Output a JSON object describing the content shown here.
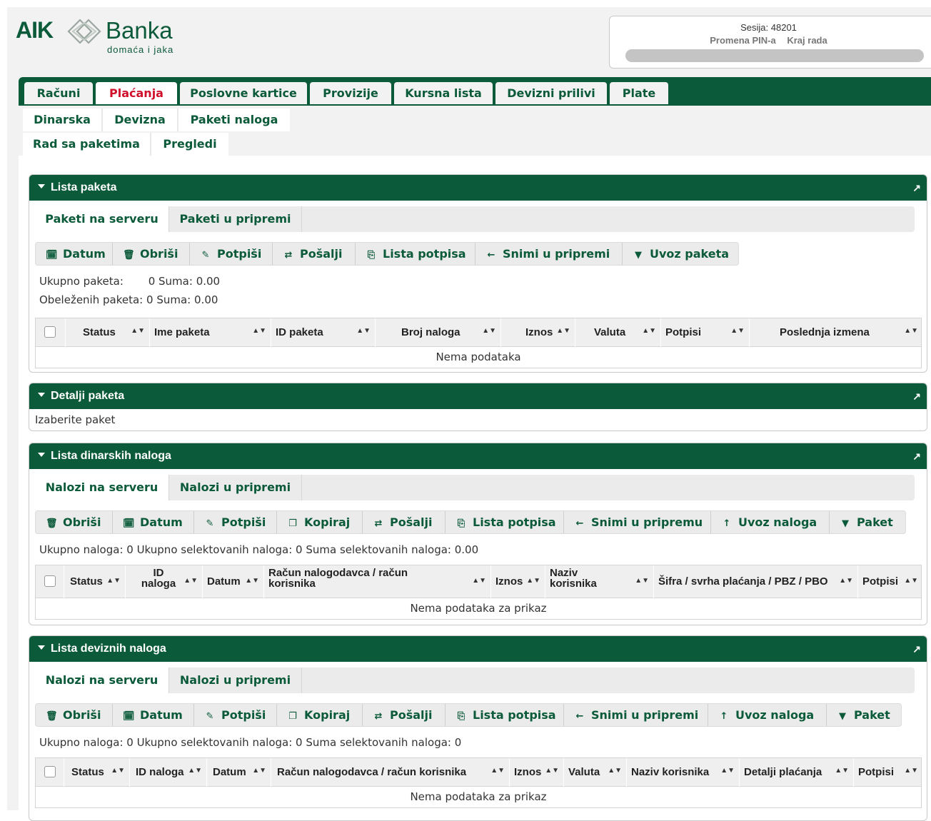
{
  "brand": {
    "name_left": "AIK",
    "name_right": "Banka",
    "tagline": "domaća i jaka",
    "color": "#0b5a3a"
  },
  "session": {
    "label": "Sesija:",
    "id": "48201",
    "change_pin": "Promena PIN-a",
    "logout": "Kraj rada"
  },
  "main_nav": [
    "Računi",
    "Plaćanja",
    "Poslovne kartice",
    "Provizije",
    "Kursna lista",
    "Devizni prilivi",
    "Plate"
  ],
  "sub_nav_1": [
    "Dinarska",
    "Devizna",
    "Paketi naloga"
  ],
  "sub_nav_2": [
    "Rad sa paketima",
    "Pregledi"
  ],
  "panels": {
    "lista_paketa": {
      "title": "Lista paketa",
      "tabs": [
        "Paketi na serveru",
        "Paketi u pripremi"
      ],
      "toolbar": [
        "Datum",
        "Obriši",
        "Potpiši",
        "Pošalji",
        "Lista potpisa",
        "Snimi u pripremi",
        "Uvoz paketa"
      ],
      "ukupno_label": "Ukupno paketa:",
      "ukupno_count": "0",
      "obelezeno_label": "Obeleženih paketa:",
      "obelezeno_count": "0",
      "suma_label": "Suma:",
      "suma_value": "0.00",
      "columns": [
        "Status",
        "Ime paketa",
        "ID paketa",
        "Broj naloga",
        "Iznos",
        "Valuta",
        "Potpisi",
        "Poslednja izmena"
      ],
      "empty": "Nema podataka"
    },
    "detalji_paketa": {
      "title": "Detalji paketa",
      "text": "Izaberite paket"
    },
    "lista_dinarskih": {
      "title": "Lista dinarskih naloga",
      "tabs": [
        "Nalozi na serveru",
        "Nalozi u pripremi"
      ],
      "toolbar": [
        "Obriši",
        "Datum",
        "Potpiši",
        "Kopiraj",
        "Pošalji",
        "Lista potpisa",
        "Snimi u pripremu",
        "Uvoz naloga",
        "Paket"
      ],
      "info": "Ukupno naloga:  0  Ukupno selektovanih naloga:  0  Suma selektovanih naloga:  0.00",
      "columns": [
        "Status",
        "ID\nnaloga",
        "Datum",
        "Račun nalogodavca / račun\nkorisnika",
        "Iznos",
        "Naziv\nkorisnika",
        "Šifra / svrha plaćanja / PBZ / PBO",
        "Potpisi"
      ],
      "empty": "Nema podataka za prikaz"
    },
    "lista_deviznih": {
      "title": "Lista deviznih naloga",
      "tabs": [
        "Nalozi na serveru",
        "Nalozi u pripremi"
      ],
      "toolbar": [
        "Obriši",
        "Datum",
        "Potpiši",
        "Kopiraj",
        "Pošalji",
        "Lista potpisa",
        "Snimi u pripremi",
        "Uvoz naloga",
        "Paket"
      ],
      "info": "Ukupno naloga:  0  Ukupno selektovanih naloga:  0  Suma selektovanih naloga:  0",
      "columns": [
        "Status",
        "ID naloga",
        "Datum",
        "Račun nalogodavca / račun korisnika",
        "Iznos",
        "Valuta",
        "Naziv korisnika",
        "Detalji plaćanja",
        "Potpisi"
      ],
      "empty": "Nema podataka za prikaz"
    }
  }
}
